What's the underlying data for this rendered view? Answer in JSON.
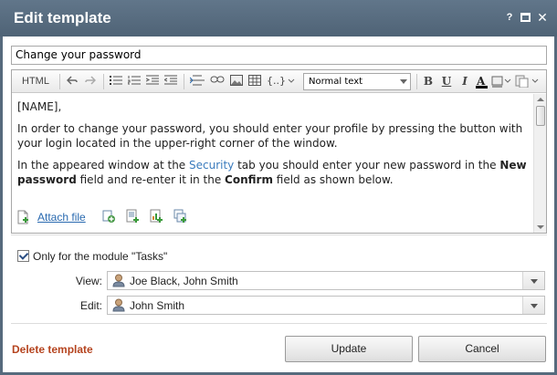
{
  "window": {
    "title": "Edit template",
    "help_label": "?",
    "close_label": "✕"
  },
  "subject": {
    "value": "Change your password"
  },
  "toolbar": {
    "html_label": "HTML",
    "format_select": "Normal text"
  },
  "content": {
    "p1": "[NAME],",
    "p2": "In order to change your password, you should enter your profile by pressing the button with your login located in the upper-right corner of the window.",
    "p3_a": "In the appeared window at the ",
    "p3_link": "Security",
    "p3_b": " tab you should enter your new password in the ",
    "p3_bold1": "New password",
    "p3_c": " field and re-enter it in the ",
    "p3_bold2": "Confirm",
    "p3_d": " field as shown below."
  },
  "attach": {
    "label": "Attach file"
  },
  "module": {
    "checkbox_label": "Only for the module \"Tasks\"",
    "checked": true
  },
  "permissions": {
    "view_label": "View:",
    "view_value": "Joe Black, John Smith",
    "edit_label": "Edit:",
    "edit_value": "John Smith"
  },
  "footer": {
    "delete_label": "Delete template",
    "update_label": "Update",
    "cancel_label": "Cancel"
  },
  "colors": {
    "titlebar": "#566a7d",
    "link": "#2a6ab0",
    "delete": "#b5441f"
  }
}
